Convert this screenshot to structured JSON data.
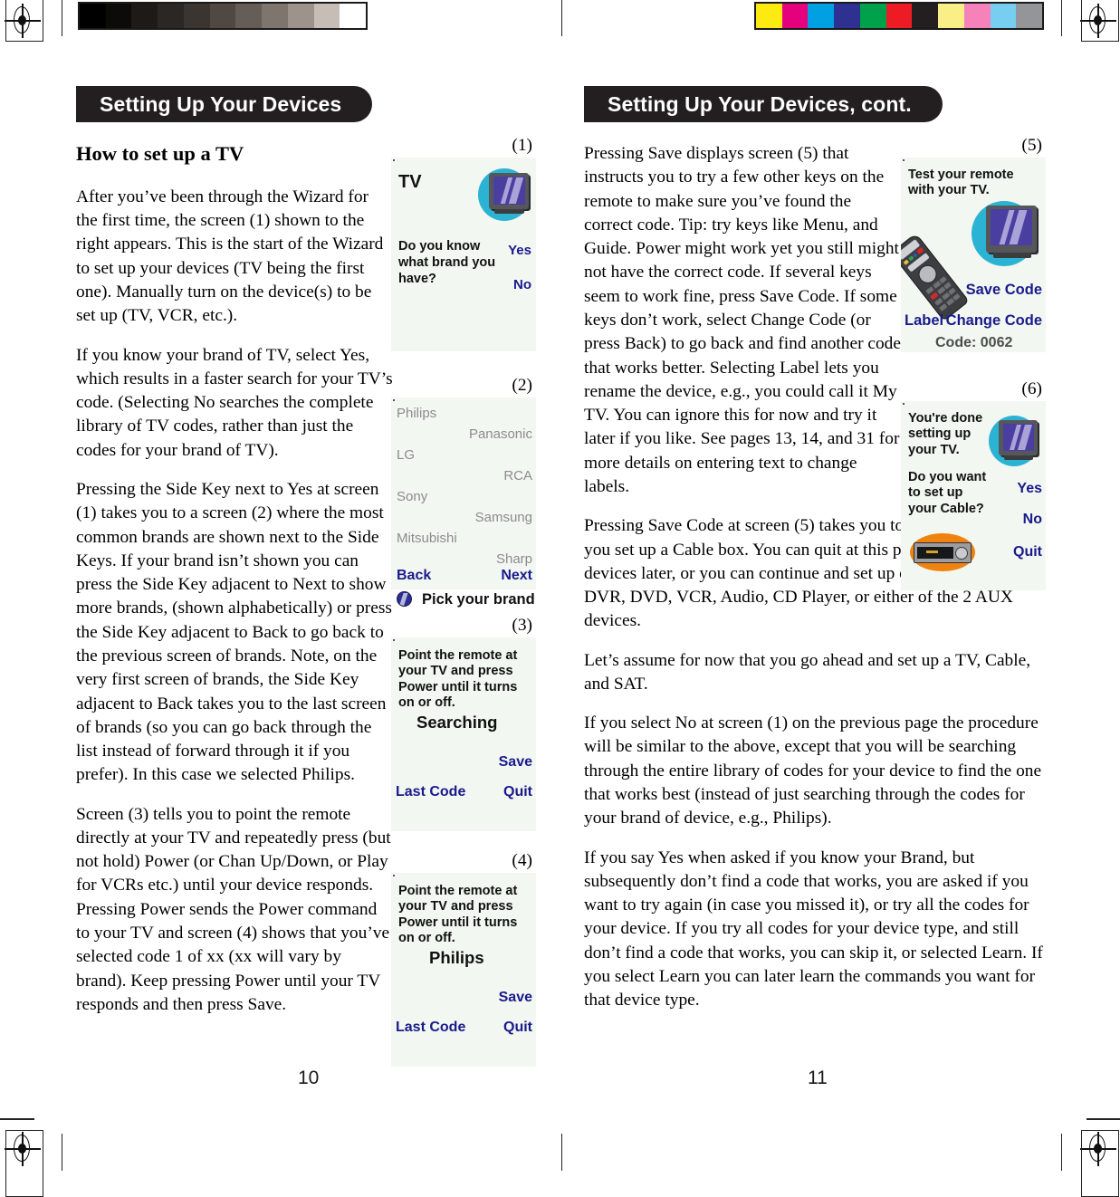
{
  "calibration": {
    "greyscale_swatches": [
      "#000000",
      "#0d0b0a",
      "#1d1a18",
      "#2b2724",
      "#3b3531",
      "#4f4843",
      "#655d57",
      "#7e756e",
      "#9d938c",
      "#c6bdb6",
      "#ffffff"
    ],
    "color_swatches": [
      "#fcea10",
      "#e5007e",
      "#00a0e3",
      "#2e3192",
      "#00a14b",
      "#ed1c24",
      "#231f20",
      "#faee86",
      "#f582b8",
      "#78cef0",
      "#939598"
    ]
  },
  "left_page": {
    "banner": "Setting Up Your Devices",
    "heading": "How to set up a TV",
    "paragraphs": [
      "After you’ve been through the Wizard for the first time, the screen (1) shown to the right appears. This is the start of the Wizard to set up your devices (TV being the first one). Manually turn on the device(s) to be set up (TV, VCR, etc.).",
      "If you know your brand of TV, select Yes, which results in a faster search for your TV’s code. (Selecting No searches the complete library of TV codes, rather than just the codes for your brand of TV).",
      "Pressing the Side Key next to Yes at screen (1) takes you to a screen (2) where the most common brands are shown next to the Side Keys. If your brand isn’t shown you can press the Side Key adjacent to Next to show more brands, (shown alphabetically) or press the Side Key adjacent to Back to go back to the previous screen of brands. Note, on the very first screen of brands, the Side Key adjacent to Back takes you to the last screen of brands (so you can go back through the list instead of forward through it if you prefer). In this case we  selected Philips.",
      "Screen (3) tells you to point the remote directly at your TV and repeatedly press (but not hold) Power (or Chan Up/Down, or Play for VCRs etc.) until your device responds. Pressing Power sends the Power command to your TV and screen (4) shows that you’ve selected code 1 of xx (xx will vary by brand). Keep pressing Power until your TV responds and then press Save."
    ],
    "page_number": "10"
  },
  "right_page": {
    "banner": "Setting Up Your Devices, cont.",
    "paragraphs": [
      "Pressing Save displays screen (5) that instructs you to try a few other keys on the remote to make sure you’ve found the correct code. Tip: try keys like Menu, and Guide. Power might work yet you still might not have the correct code. If several keys seem to work fine, press Save Code. If some keys don’t work, select Change Code (or press Back) to go back and find another code that works better. Selecting Label lets you rename the device, e.g., you could call it My TV. You can ignore this for now and try it later if you like. See pages 13, 14, and 31 for more details on entering text to change labels.",
      "Pressing Save Code at screen (5) takes you to screen (6) where you set up a Cable box. You can quit at this point and set up other devices later, or you can continue and set up other devices - SAT, DVR, DVD, VCR, Audio, CD Player, or either of the 2 AUX devices.",
      "Let’s assume for now that you go ahead and set up a TV, Cable, and SAT.",
      "If you select No at screen (1) on the previous page the procedure will be similar to the above, except that you will be searching through the entire library of codes for your device to find the one that works best (instead of just searching through the codes for your brand of device, e.g., Philips).",
      "If you say Yes when asked if you know your Brand, but subsequently don’t find a code that works, you are asked if you want to try again (in case you missed it), or try all the codes for your device. If you try all codes for your device type, and still don’t find a code that works, you can skip it, or selected Learn. If you select Learn you can later learn the commands you want for that device type."
    ],
    "page_number": "11"
  },
  "figures": {
    "screen1": {
      "number": "(1)",
      "device_label": "TV",
      "question": "Do you know\nwhat brand you\nhave?",
      "yes": "Yes",
      "no": "No",
      "icon": "tv-icon"
    },
    "screen2": {
      "number": "(2)",
      "brands_left": [
        "Philips",
        "LG",
        "Sony",
        "Mitsubishi"
      ],
      "brands_right": [
        "Panasonic",
        "RCA",
        "Samsung",
        "Sharp"
      ],
      "back": "Back",
      "next": "Next",
      "prompt": "Pick your brand",
      "icon": "pick-brand-icon"
    },
    "screen3": {
      "number": "(3)",
      "instruction": "Point the remote at\nyour TV and press\nPower until it turns\non or off.",
      "status": "Searching",
      "save": "Save",
      "last_code": "Last Code",
      "quit": "Quit"
    },
    "screen4": {
      "number": "(4)",
      "instruction": "Point the remote at\nyour TV and press\nPower until it turns\non or off.",
      "status": "Philips",
      "save": "Save",
      "last_code": "Last Code",
      "quit": "Quit"
    },
    "screen5": {
      "number": "(5)",
      "instruction": "Test your remote\nwith your TV.",
      "save_code": "Save Code",
      "label": "Label",
      "change_code": "Change Code",
      "code": "Code: 0062",
      "icons": [
        "tv-icon",
        "remote-icon"
      ]
    },
    "screen6": {
      "number": "(6)",
      "done_message": "You're done\nsetting up\nyour TV.",
      "question": "Do you want\nto set up\nyour Cable?",
      "yes": "Yes",
      "no": "No",
      "quit": "Quit",
      "icons": [
        "tv-icon",
        "cable-box-icon"
      ]
    }
  },
  "colors": {
    "banner_bg": "#231f20",
    "screen_bg": "#f2f7f1",
    "screen_blue_text": "#1a1a8c",
    "screen_grey_text": "#8c8c8c",
    "tv_disc": "#2bb3d4",
    "cable_disc": "#f0820f"
  }
}
